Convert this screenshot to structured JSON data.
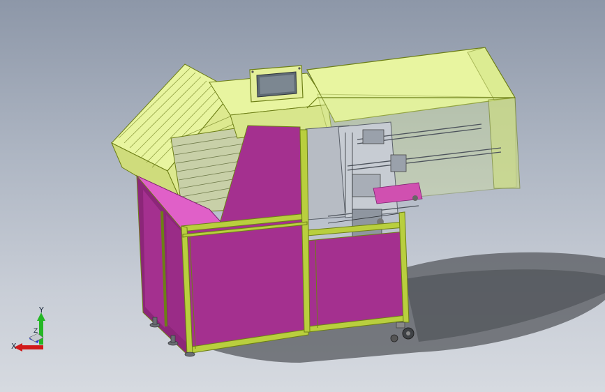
{
  "viewport": {
    "background_top": "#8d97a8",
    "background_bottom": "#d6dae0"
  },
  "colors": {
    "magenta_panel": "#a4308f",
    "magenta_dark": "#7d2270",
    "yellow_green": "#e8f5a0",
    "frame_green": "#b9cf3e",
    "frame_dark": "#6d7f16",
    "guard_glass": "#d9ea98",
    "grey_metal": "#b7bcc4",
    "shadow": "#4a4d52"
  },
  "triad": {
    "x_label": "X",
    "y_label": "Y",
    "z_label": "Z",
    "x_color": "#d11a1a",
    "y_color": "#25b725",
    "z_color": "#2a3bd6"
  },
  "machine": {
    "name": "machine-3d-model"
  }
}
